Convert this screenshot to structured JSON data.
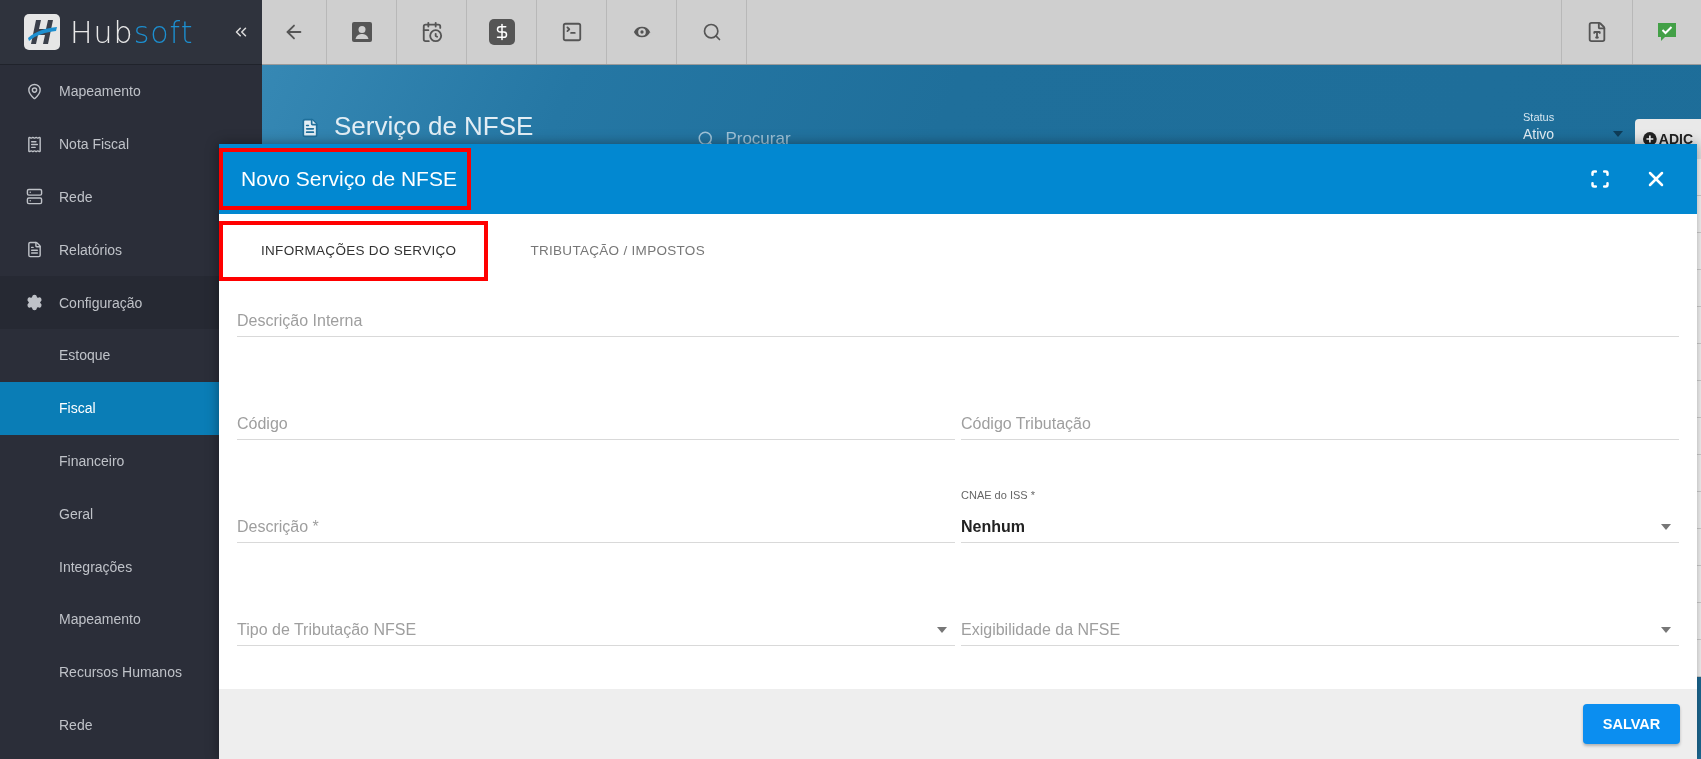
{
  "logo": {
    "part_a": "Hub",
    "part_b": "soft"
  },
  "sidebar": {
    "items": [
      {
        "label": "Mapeamento",
        "selected": false
      },
      {
        "label": "Nota Fiscal",
        "selected": false
      },
      {
        "label": "Rede",
        "selected": false
      },
      {
        "label": "Relatórios",
        "selected": false
      },
      {
        "label": "Configuração",
        "selected": false,
        "expanded": true,
        "children": [
          {
            "label": "Estoque",
            "selected": false
          },
          {
            "label": "Fiscal",
            "selected": true
          },
          {
            "label": "Financeiro",
            "selected": false
          },
          {
            "label": "Geral",
            "selected": false
          },
          {
            "label": "Integrações",
            "selected": false
          },
          {
            "label": "Mapeamento",
            "selected": false
          },
          {
            "label": "Recursos Humanos",
            "selected": false
          },
          {
            "label": "Rede",
            "selected": false
          }
        ]
      }
    ]
  },
  "page": {
    "title": "Serviço de NFSE",
    "search": {
      "placeholder": "Procurar"
    },
    "status": {
      "label": "Status",
      "value": "Ativo"
    },
    "add_button": "ADIC"
  },
  "modal": {
    "title": "Novo Serviço de NFSE",
    "title_highlighted": true,
    "tabs": [
      {
        "label": "INFORMAÇÕES DO SERVIÇO",
        "selected": true,
        "highlighted": true
      },
      {
        "label": "TRIBUTAÇÃO / IMPOSTOS",
        "selected": false,
        "highlighted": false
      }
    ],
    "rows": [
      [
        {
          "kind": "text",
          "label": "Descrição Interna"
        }
      ],
      [
        {
          "kind": "text",
          "label": "Código"
        },
        {
          "kind": "text",
          "label": "Código Tributação"
        }
      ],
      [
        {
          "kind": "text",
          "label": "Descrição *"
        },
        {
          "kind": "select",
          "label": "CNAE do ISS *",
          "value": "Nenhum"
        }
      ],
      [
        {
          "kind": "select",
          "label": "Tipo de Tributação NFSE"
        },
        {
          "kind": "select",
          "label": "Exigibilidade da NFSE"
        }
      ]
    ],
    "save_button": "SALVAR"
  }
}
